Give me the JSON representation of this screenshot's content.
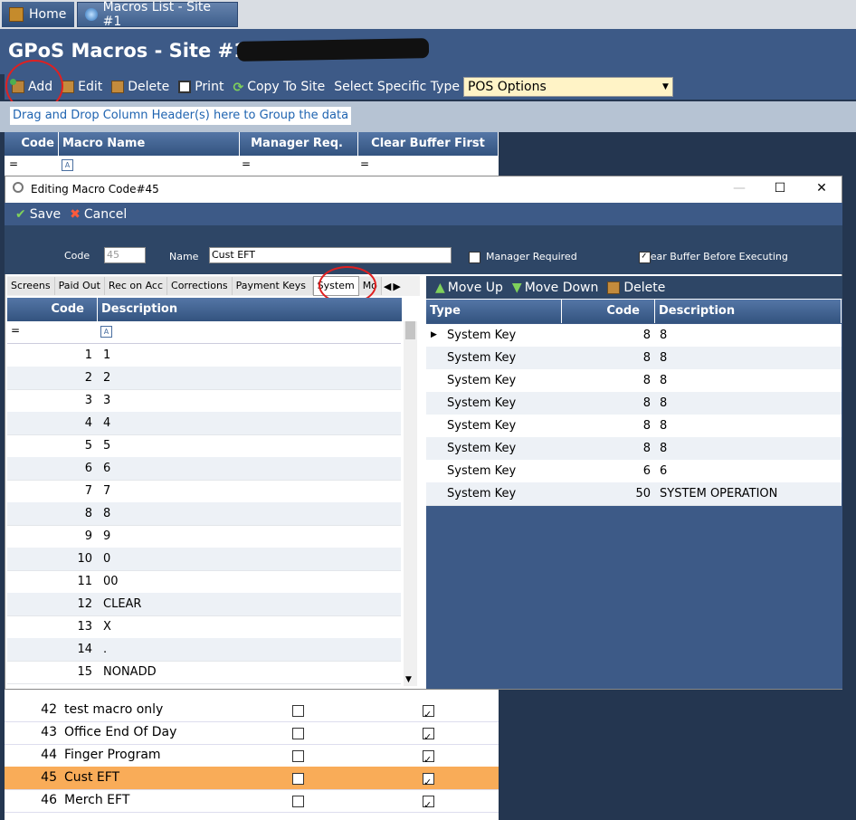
{
  "tabs": {
    "home": "Home",
    "macros": "Macros List - Site #1"
  },
  "page": {
    "title": "GPoS Macros - Site #1"
  },
  "toolbar": {
    "add": "Add",
    "edit": "Edit",
    "delete": "Delete",
    "print": "Print",
    "copy": "Copy To Site",
    "select_label": "Select Specific Type",
    "select_value": "POS Options"
  },
  "group_hint": "Drag and Drop Column Header(s) here to Group the data",
  "back_grid": {
    "headers": [
      "Code",
      "Macro Name",
      "Manager Req.",
      "Clear Buffer First"
    ],
    "rows": [
      {
        "code": "42",
        "name": "test macro only",
        "mgr": false,
        "clear": true
      },
      {
        "code": "43",
        "name": "Office End Of Day",
        "mgr": false,
        "clear": true
      },
      {
        "code": "44",
        "name": "Finger Program",
        "mgr": false,
        "clear": true
      },
      {
        "code": "45",
        "name": "Cust EFT",
        "mgr": false,
        "clear": true,
        "selected": true
      },
      {
        "code": "46",
        "name": "Merch EFT",
        "mgr": false,
        "clear": true
      }
    ]
  },
  "dialog": {
    "title": "Editing Macro Code#45",
    "save": "Save",
    "cancel": "Cancel",
    "code_label": "Code",
    "code_value": "45",
    "name_label": "Name",
    "name_value": "Cust EFT",
    "manager_label": "Manager Required",
    "manager_checked": false,
    "clear_label": "Clear Buffer Before Executing",
    "clear_checked": true,
    "subtabs": [
      "Screens",
      "Paid Out",
      "Rec on Acc",
      "Corrections",
      "Payment Keys",
      "System",
      "Mo"
    ],
    "active_subtab": "System",
    "left_grid": {
      "headers": [
        "Code",
        "Description"
      ],
      "rows": [
        {
          "code": "1",
          "desc": "1"
        },
        {
          "code": "2",
          "desc": "2"
        },
        {
          "code": "3",
          "desc": "3"
        },
        {
          "code": "4",
          "desc": "4"
        },
        {
          "code": "5",
          "desc": "5"
        },
        {
          "code": "6",
          "desc": "6"
        },
        {
          "code": "7",
          "desc": "7"
        },
        {
          "code": "8",
          "desc": "8"
        },
        {
          "code": "9",
          "desc": "9"
        },
        {
          "code": "10",
          "desc": "0"
        },
        {
          "code": "11",
          "desc": "00"
        },
        {
          "code": "12",
          "desc": "CLEAR"
        },
        {
          "code": "13",
          "desc": "X"
        },
        {
          "code": "14",
          "desc": "."
        },
        {
          "code": "15",
          "desc": "NONADD"
        }
      ]
    },
    "right_toolbar": {
      "move_up": "Move Up",
      "move_down": "Move Down",
      "delete": "Delete"
    },
    "right_grid": {
      "headers": [
        "Type",
        "Code",
        "Description"
      ],
      "rows": [
        {
          "type": "System Key",
          "code": "8",
          "desc": "8"
        },
        {
          "type": "System Key",
          "code": "8",
          "desc": "8"
        },
        {
          "type": "System Key",
          "code": "8",
          "desc": "8"
        },
        {
          "type": "System Key",
          "code": "8",
          "desc": "8"
        },
        {
          "type": "System Key",
          "code": "8",
          "desc": "8"
        },
        {
          "type": "System Key",
          "code": "8",
          "desc": "8"
        },
        {
          "type": "System Key",
          "code": "6",
          "desc": "6"
        },
        {
          "type": "System Key",
          "code": "50",
          "desc": "SYSTEM OPERATION"
        }
      ]
    }
  },
  "colors": {
    "header_blue": "#3d5a87",
    "selected_row": "#f9ac58",
    "annotation": "#e02020"
  }
}
